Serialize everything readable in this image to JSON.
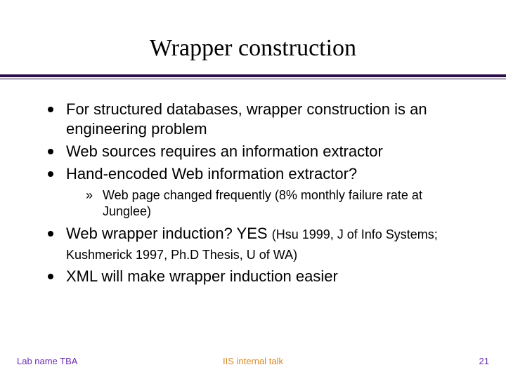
{
  "title": "Wrapper construction",
  "bullets": {
    "b1": "For structured databases, wrapper construction is an engineering problem",
    "b2": "Web sources requires an information extractor",
    "b3": "Hand-encoded Web information extractor?",
    "b3_sub1": "Web page changed frequently (8% monthly failure rate at Junglee)",
    "b4_main": "Web wrapper induction? YES ",
    "b4_cite": "(Hsu 1999, J of Info Systems; Kushmerick 1997, Ph.D Thesis, U of WA)",
    "b5": "XML will make wrapper induction easier"
  },
  "footer": {
    "left": "Lab name TBA",
    "center": "IIS internal talk",
    "page": "21"
  }
}
